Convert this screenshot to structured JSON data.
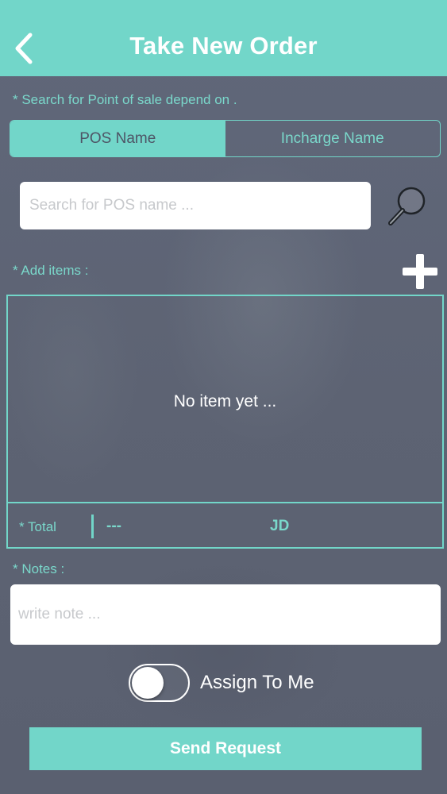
{
  "header": {
    "title": "Take New Order",
    "back_icon": "chevron-left-icon"
  },
  "pos_search": {
    "hint": "* Search for Point of sale depend on .",
    "segments": [
      {
        "label": "POS Name",
        "active": true
      },
      {
        "label": "Incharge Name",
        "active": false
      }
    ],
    "placeholder": "Search for POS name ...",
    "search_icon": "magnifier-icon"
  },
  "items": {
    "label": "* Add items :",
    "add_icon": "plus-icon",
    "empty_text": "No item yet ...",
    "total_label": "* Total",
    "total_value": "---",
    "currency": "JD"
  },
  "notes": {
    "label": "* Notes :",
    "placeholder": "write note ..."
  },
  "assign": {
    "label": "Assign To Me",
    "on": false
  },
  "send_label": "Send Request",
  "colors": {
    "accent": "#72d6c9",
    "background": "#5d6373",
    "text": "#ffffff"
  }
}
